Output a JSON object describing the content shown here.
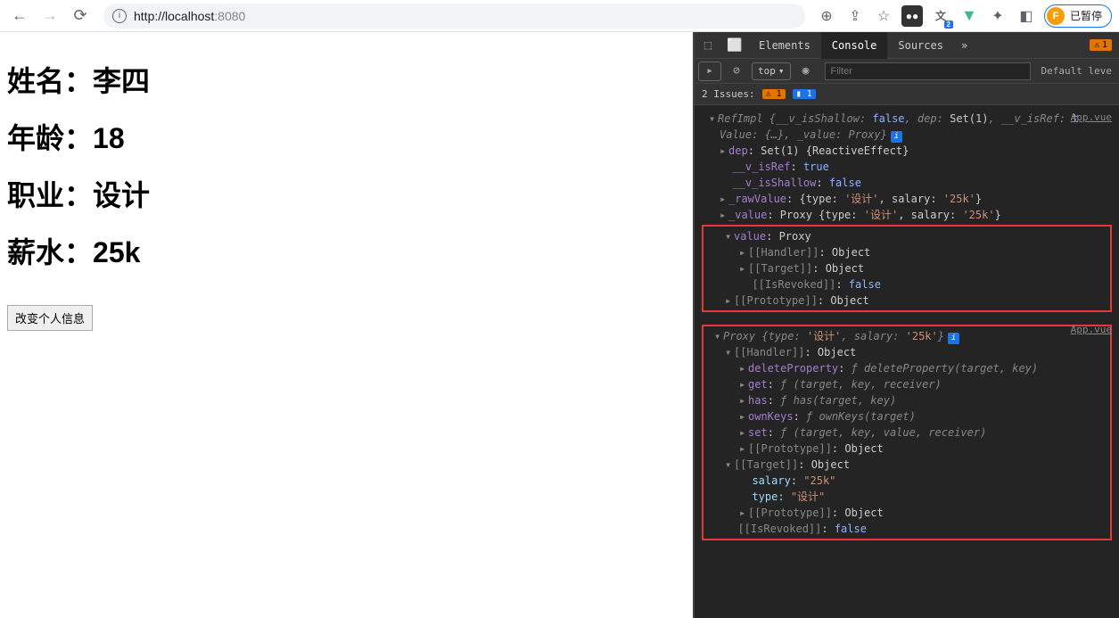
{
  "browser": {
    "url_prefix": "http://localhost",
    "url_port": ":8080",
    "profile_letter": "F",
    "profile_label": "已暂停",
    "translate_badge": "2",
    "errors_badge": "1"
  },
  "page": {
    "name_label": "姓名：",
    "name_value": "李四",
    "age_label": "年龄：",
    "age_value": "18",
    "job_label": "职业：",
    "job_value": "设计",
    "salary_label": "薪水：",
    "salary_value": "25k",
    "button": "改变个人信息"
  },
  "devtools": {
    "tabs": {
      "elements": "Elements",
      "console": "Console",
      "sources": "Sources"
    },
    "context": "top",
    "filter_placeholder": "Filter",
    "levels": "Default leve",
    "issues_label": "2 Issues:",
    "issues_warn": "1",
    "issues_info": "1",
    "src1": "App.vue",
    "src2": "App.vue",
    "log1": {
      "header": "RefImpl {__v_isShallow: false, dep: Set(1), __v_isRef: t",
      "header2": "Value: {…}, _value: Proxy}",
      "dep": "dep: Set(1) {ReactiveEffect}",
      "isRef": "__v_isRef: true",
      "isShallow": "__v_isShallow: false",
      "rawValue": "_rawValue: {type: '设计', salary: '25k'}",
      "value": "_value: Proxy {type: '设计', salary: '25k'}",
      "valueProxy": "value: Proxy",
      "handler": "[[Handler]]: Object",
      "target": "[[Target]]: Object",
      "isRevoked": "[[IsRevoked]]: false",
      "proto": "[[Prototype]]: Object"
    },
    "log2": {
      "header": "Proxy {type: '设计', salary: '25k'}",
      "handler": "[[Handler]]: Object",
      "deleteProperty": "deleteProperty: ƒ deleteProperty(target, key)",
      "get": "get: ƒ (target, key, receiver)",
      "has": "has: ƒ has(target, key)",
      "ownKeys": "ownKeys: ƒ ownKeys(target)",
      "set": "set: ƒ (target, key, value, receiver)",
      "proto1": "[[Prototype]]: Object",
      "target": "[[Target]]: Object",
      "salary_k": "salary:",
      "salary_v": "\"25k\"",
      "type_k": "type:",
      "type_v": "\"设计\"",
      "proto2": "[[Prototype]]: Object",
      "isRevoked": "[[IsRevoked]]: false"
    }
  }
}
